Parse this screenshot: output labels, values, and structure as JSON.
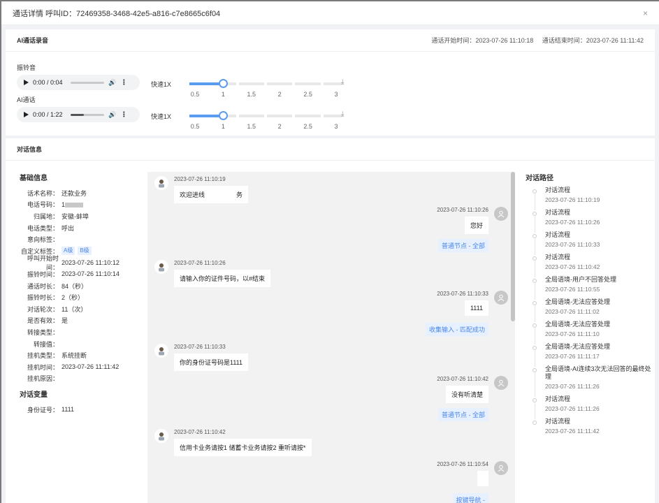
{
  "modal": {
    "title": "通话详情 呼叫ID：72469358-3468-42e5-a816-c7e8665c6f04",
    "close": "×"
  },
  "recording": {
    "title": "AI通话录音",
    "start_time": "通话开始时间：2023-07-26 11:10:18",
    "end_time": "通话结束时间：2023-07-26 11:11:42",
    "ring": {
      "label": "振铃音",
      "time": "0:00 / 0:04",
      "speed_label": "快速1X",
      "progress": 0
    },
    "ai": {
      "label": "AI通话",
      "time": "0:00 / 1:22",
      "speed_label": "快速1X",
      "progress": 0.4
    },
    "speed_ticks": [
      "0.5",
      "1",
      "1.5",
      "2",
      "2.5",
      "3"
    ],
    "speed_value": 1
  },
  "dialog": {
    "title": "对话信息",
    "basic": {
      "title": "基础信息",
      "rows": [
        {
          "k": "话术名称：",
          "v": "还款业务"
        },
        {
          "k": "电话号码：",
          "v": "1"
        },
        {
          "k": "归属地：",
          "v": "安徽-蚌埠"
        },
        {
          "k": "电话类型：",
          "v": "呼出"
        },
        {
          "k": "意向标签：",
          "v": ""
        },
        {
          "k": "自定义标签：",
          "v": ""
        },
        {
          "k": "呼叫开始时间：",
          "v": "2023-07-26 11:10:12"
        },
        {
          "k": "振铃时间：",
          "v": "2023-07-26 11:10:14"
        },
        {
          "k": "通话时长：",
          "v": "84（秒）"
        },
        {
          "k": "振铃时长：",
          "v": "2（秒）"
        },
        {
          "k": "对话轮次：",
          "v": "11（次）"
        },
        {
          "k": "是否有效：",
          "v": "是"
        },
        {
          "k": "转接类型：",
          "v": ""
        },
        {
          "k": "转接值：",
          "v": ""
        },
        {
          "k": "挂机类型：",
          "v": "系统挂断"
        },
        {
          "k": "挂机时间：",
          "v": "2023-07-26 11:11:42"
        },
        {
          "k": "挂机原因：",
          "v": ""
        }
      ],
      "tags": [
        "A级",
        "B级"
      ]
    },
    "vars": {
      "title": "对话变量",
      "rows": [
        {
          "k": "身份证号：",
          "v": "1111"
        }
      ]
    },
    "messages": [
      {
        "side": "l",
        "ts": "2023-07-26 11:10:19",
        "text": "欢迎进线　　　　　务"
      },
      {
        "side": "r",
        "ts": "2023-07-26 11:10:26",
        "text": "您好",
        "tag": "普通节点 - 全部"
      },
      {
        "side": "l",
        "ts": "2023-07-26 11:10:26",
        "text": "请输入你的证件号码，以#结束"
      },
      {
        "side": "r",
        "ts": "2023-07-26 11:10:33",
        "text": "1111",
        "tag": "收集输入 - 匹配成功"
      },
      {
        "side": "l",
        "ts": "2023-07-26 11:10:33",
        "text": "你的身份证号码是1111"
      },
      {
        "side": "r",
        "ts": "2023-07-26 11:10:42",
        "text": "没有听清楚",
        "tag": "普通节点 - 全部"
      },
      {
        "side": "l",
        "ts": "2023-07-26 11:10:42",
        "text": "信用卡业务请按1 储蓄卡业务请按2 重听请按*"
      },
      {
        "side": "r",
        "ts": "2023-07-26 11:10:54",
        "text": "",
        "tag": "按键导航 -"
      }
    ],
    "path": {
      "title": "对话路径",
      "items": [
        {
          "name": "对话流程",
          "time": "2023-07-26 11:10:19"
        },
        {
          "name": "对话流程",
          "time": "2023-07-26 11:10:26"
        },
        {
          "name": "对话流程",
          "time": "2023-07-26 11:10:33"
        },
        {
          "name": "对话流程",
          "time": "2023-07-26 11:10:42"
        },
        {
          "name": "全局语境-用户不回答处理",
          "time": "2023-07-26 11:10:55"
        },
        {
          "name": "全局语境-无法应答处理",
          "time": "2023-07-26 11:11:02"
        },
        {
          "name": "全局语境-无法应答处理",
          "time": "2023-07-26 11:11:10"
        },
        {
          "name": "全局语境-无法应答处理",
          "time": "2023-07-26 11:11:17"
        },
        {
          "name": "全局语境-AI连续3次无法回答的最终处理",
          "time": "2023-07-26 11:11:26"
        },
        {
          "name": "对话流程",
          "time": "2023-07-26 11:11:26"
        },
        {
          "name": "对话流程",
          "time": "2023-07-26 11:11:42"
        }
      ]
    }
  }
}
